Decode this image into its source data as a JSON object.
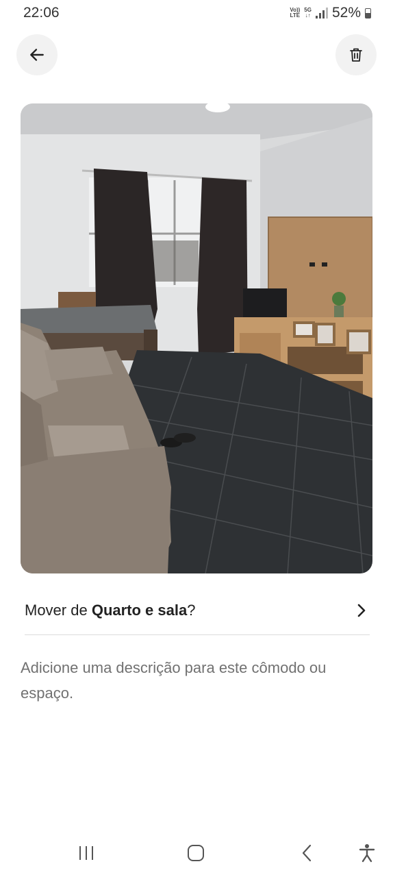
{
  "status_bar": {
    "time": "22:06",
    "volte_top": "Vo))",
    "volte_bottom": "LTE",
    "network_top": "5G",
    "network_bottom": "↓↑",
    "battery": "52%"
  },
  "header": {
    "back_icon": "arrow-left-icon",
    "delete_icon": "trash-icon"
  },
  "photo": {
    "description_icon": "room-photo"
  },
  "move_row": {
    "prefix": "Mover de ",
    "room_name": "Quarto e sala",
    "suffix": "?",
    "chevron_icon": "chevron-right-icon"
  },
  "description_prompt": "Adicione uma descrição para este cômodo ou espaço.",
  "nav_bar": {
    "recents_icon": "recents-icon",
    "home_icon": "home-icon",
    "back_icon": "back-icon",
    "accessibility_icon": "accessibility-icon"
  },
  "colors": {
    "button_bg": "#f2f2f2",
    "divider": "#dcdcdc",
    "secondary_text": "#717171"
  }
}
